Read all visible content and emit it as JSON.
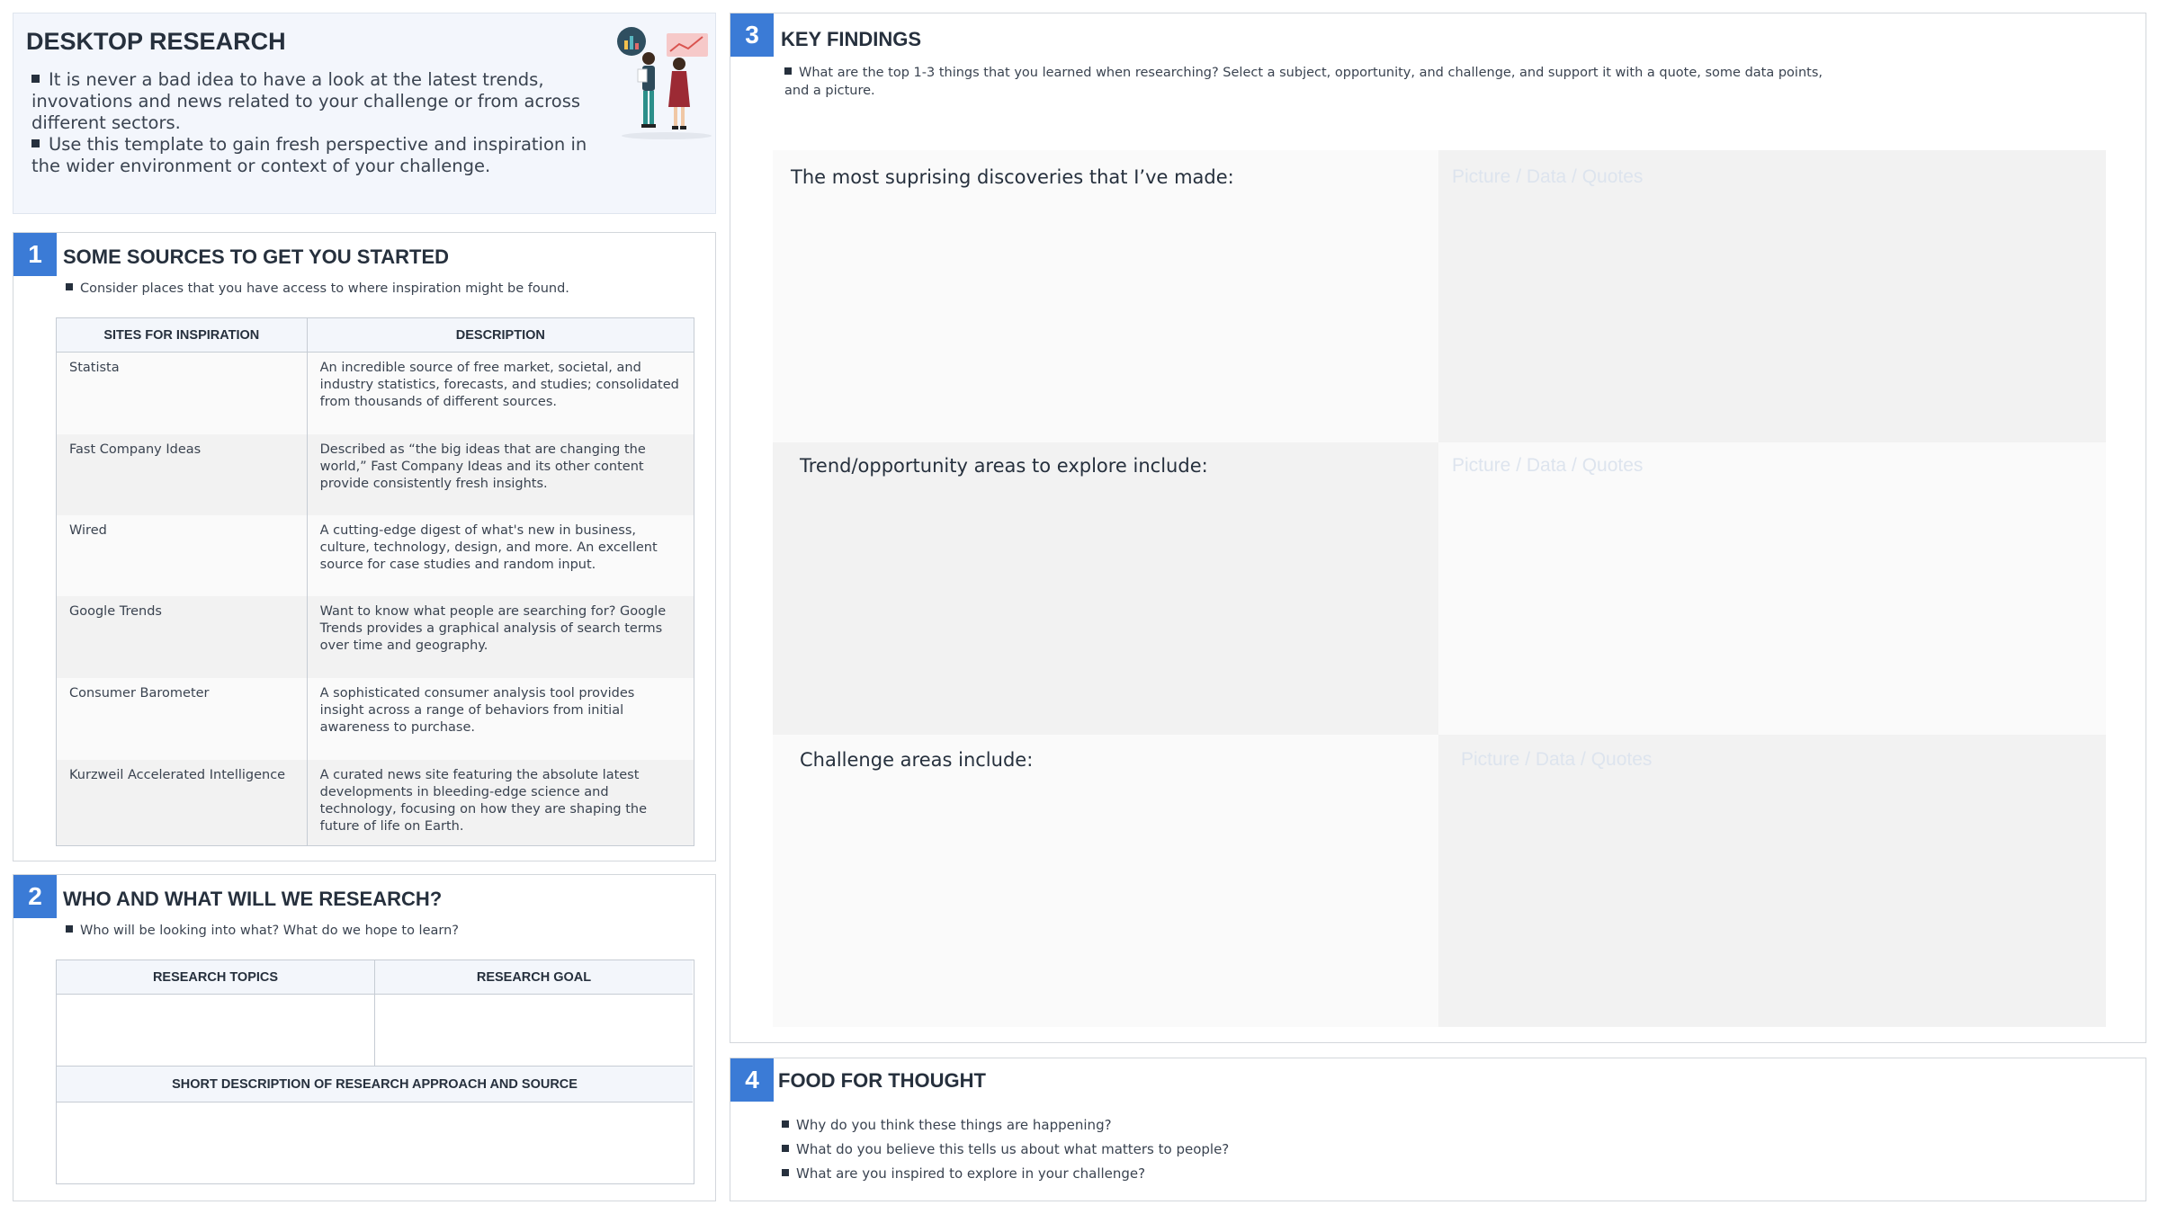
{
  "intro": {
    "title": "DESKTOP RESEARCH",
    "bullets": [
      "It is never a bad idea to have a look at the latest trends, invovations and news related to your challenge or from across different sectors.",
      "Use this template to gain fresh perspective and inspiration in the wider environment or context of your challenge."
    ]
  },
  "section1": {
    "number": "1",
    "title": "SOME SOURCES TO GET YOU STARTED",
    "hint": "Consider places that you have access to where inspiration might be found.",
    "columns": [
      "SITES FOR INSPIRATION",
      "DESCRIPTION"
    ],
    "rows": [
      {
        "site": "Statista",
        "description": "An incredible source of free market, societal, and industry statistics, forecasts, and studies; consolidated from thousands of different sources."
      },
      {
        "site": "Fast Company Ideas",
        "description": "Described as “the big ideas that are changing the world,” Fast Company Ideas and its other content provide consistently fresh insights."
      },
      {
        "site": "Wired",
        "description": "A cutting-edge digest of what's new in business, culture, technology, design, and more. An excellent source for case studies and random input."
      },
      {
        "site": "Google Trends",
        "description": "Want to know what people are searching for? Google Trends provides a graphical analysis of search terms over time and geography."
      },
      {
        "site": "Consumer Barometer",
        "description": "A sophisticated consumer analysis tool provides insight across a range of behaviors from initial awareness to purchase."
      },
      {
        "site": "Kurzweil Accelerated Intelligence",
        "description": "A curated news site featuring the absolute latest developments in bleeding-edge science and technology, focusing on how they are shaping the future of life on Earth."
      }
    ]
  },
  "section2": {
    "number": "2",
    "title": "WHO AND WHAT WILL WE RESEARCH?",
    "hint": "Who will be looking into what? What do we hope to learn?",
    "columns": [
      "RESEARCH TOPICS",
      "RESEARCH GOAL"
    ],
    "approach_header": "SHORT DESCRIPTION OF RESEARCH APPROACH AND SOURCE"
  },
  "section3": {
    "number": "3",
    "title": "KEY FINDINGS",
    "hint": "What are the top 1-3 things that you learned when researching? Select a subject, opportunity, and challenge, and support it with a quote, some data points, and a picture.",
    "findings": [
      {
        "label": "The most suprising discoveries that I’ve made:",
        "placeholder": "Picture / Data / Quotes"
      },
      {
        "label": "Trend/opportunity areas to explore include:",
        "placeholder": "Picture / Data / Quotes"
      },
      {
        "label": "Challenge areas include:",
        "placeholder": "Picture / Data / Quotes"
      }
    ]
  },
  "section4": {
    "number": "4",
    "title": "FOOD FOR THOUGHT",
    "questions": [
      "Why do you think these things are happening?",
      "What do you believe this tells us about what matters to people?",
      "What are you inspired to explore in your challenge?"
    ]
  },
  "colors": {
    "accent": "#3b7bd6",
    "intro_bg": "#f3f6fc",
    "placeholder_text": "#dde4ee"
  }
}
